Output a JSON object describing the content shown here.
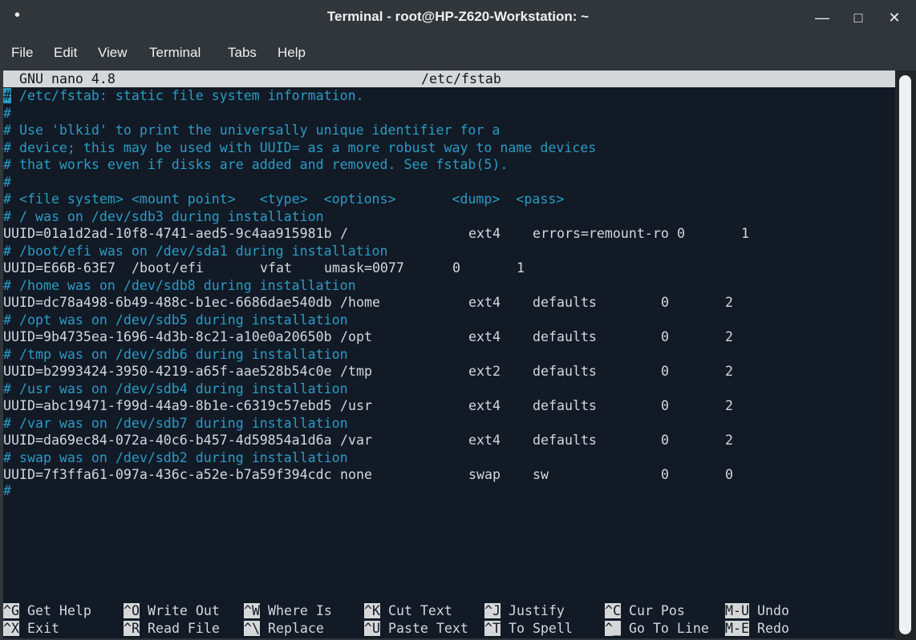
{
  "window": {
    "title": "Terminal - root@HP-Z620-Workstation: ~"
  },
  "menu": [
    "File",
    "Edit",
    "View",
    "Terminal",
    "Tabs",
    "Help"
  ],
  "nano": {
    "version": "GNU nano 4.8",
    "filename": "/etc/fstab"
  },
  "comments": [
    " /etc/fstab: static file system information.",
    "#",
    "# Use 'blkid' to print the universally unique identifier for a",
    "# device; this may be used with UUID= as a more robust way to name devices",
    "# that works even if disks are added and removed. See fstab(5).",
    "#",
    "# <file system> <mount point>   <type>  <options>       <dump>  <pass>",
    "# / was on /dev/sdb3 during installation"
  ],
  "entries": [
    {
      "comment": "# / was on /dev/sdb3 during installation",
      "fs": "UUID=01a1d2ad-10f8-4741-aed5-9c4aa915981b",
      "mount": "/",
      "type": "ext4",
      "options": "errors=remount-ro",
      "dump": "0",
      "pass": "1"
    },
    {
      "comment": "# /boot/efi was on /dev/sda1 during installation",
      "fs": "UUID=E66B-63E7",
      "mount": "/boot/efi",
      "type": "vfat",
      "options": "umask=0077",
      "dump": "0",
      "pass": "1"
    },
    {
      "comment": "# /home was on /dev/sdb8 during installation",
      "fs": "UUID=dc78a498-6b49-488c-b1ec-6686dae540db",
      "mount": "/home",
      "type": "ext4",
      "options": "defaults",
      "dump": "0",
      "pass": "2"
    },
    {
      "comment": "# /opt was on /dev/sdb5 during installation",
      "fs": "UUID=9b4735ea-1696-4d3b-8c21-a10e0a20650b",
      "mount": "/opt",
      "type": "ext4",
      "options": "defaults",
      "dump": "0",
      "pass": "2"
    },
    {
      "comment": "# /tmp was on /dev/sdb6 during installation",
      "fs": "UUID=b2993424-3950-4219-a65f-aae528b54c0e",
      "mount": "/tmp",
      "type": "ext2",
      "options": "defaults",
      "dump": "0",
      "pass": "2"
    },
    {
      "comment": "# /usr was on /dev/sdb4 during installation",
      "fs": "UUID=abc19471-f99d-44a9-8b1e-c6319c57ebd5",
      "mount": "/usr",
      "type": "ext4",
      "options": "defaults",
      "dump": "0",
      "pass": "2"
    },
    {
      "comment": "# /var was on /dev/sdb7 during installation",
      "fs": "UUID=da69ec84-072a-40c6-b457-4d59854a1d6a",
      "mount": "/var",
      "type": "ext4",
      "options": "defaults",
      "dump": "0",
      "pass": "2"
    },
    {
      "comment": "# swap was on /dev/sdb2 during installation",
      "fs": "UUID=7f3ffa61-097a-436c-a52e-b7a59f394cdc",
      "mount": "none",
      "type": "swap",
      "options": "sw",
      "dump": "0",
      "pass": "0"
    }
  ],
  "trailing": "#",
  "shortcuts": [
    {
      "key": "^G",
      "label": "Get Help"
    },
    {
      "key": "^O",
      "label": "Write Out"
    },
    {
      "key": "^W",
      "label": "Where Is"
    },
    {
      "key": "^K",
      "label": "Cut Text"
    },
    {
      "key": "^J",
      "label": "Justify"
    },
    {
      "key": "^C",
      "label": "Cur Pos"
    },
    {
      "key": "M-U",
      "label": "Undo"
    },
    {
      "key": "^X",
      "label": "Exit"
    },
    {
      "key": "^R",
      "label": "Read File"
    },
    {
      "key": "^\\",
      "label": "Replace"
    },
    {
      "key": "^U",
      "label": "Paste Text"
    },
    {
      "key": "^T",
      "label": "To Spell"
    },
    {
      "key": "^_",
      "label": "Go To Line"
    },
    {
      "key": "M-E",
      "label": "Redo"
    }
  ],
  "colors": {
    "background": "#121a26",
    "comment": "#2a9cc4",
    "text": "#d4d8de",
    "bar": "#d6d7d8"
  }
}
